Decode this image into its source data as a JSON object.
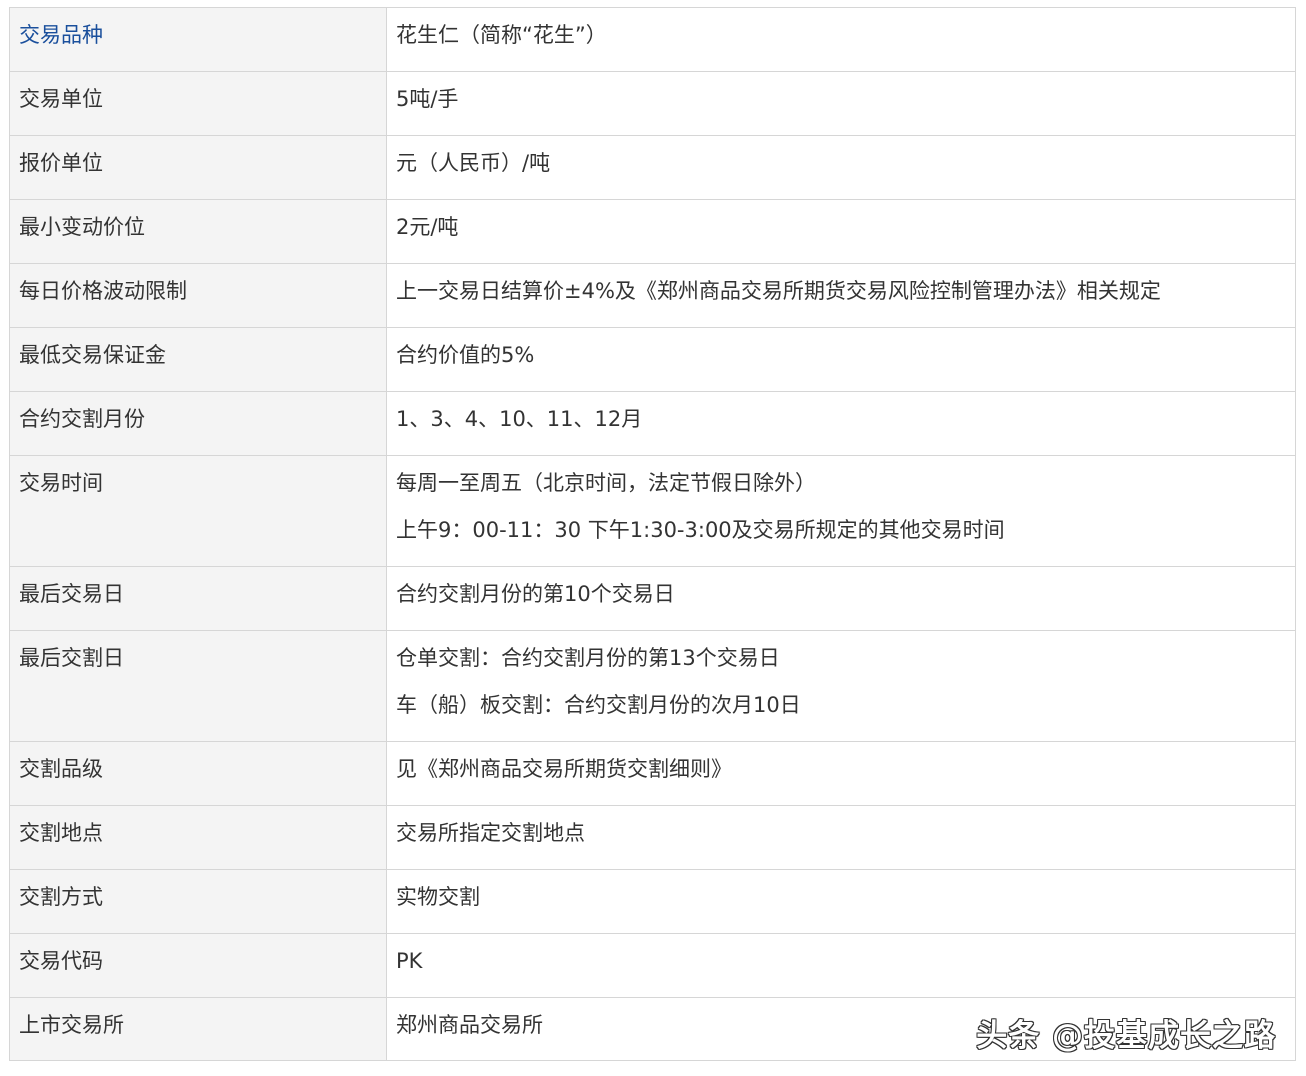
{
  "rows": [
    {
      "label": "交易品种",
      "values": [
        "花生仁（简称“花生”）"
      ]
    },
    {
      "label": "交易单位",
      "values": [
        "5吨/手"
      ]
    },
    {
      "label": "报价单位",
      "values": [
        "元（人民币）/吨"
      ]
    },
    {
      "label": "最小变动价位",
      "values": [
        "2元/吨"
      ]
    },
    {
      "label": "每日价格波动限制",
      "values": [
        "上一交易日结算价±4%及《郑州商品交易所期货交易风险控制管理办法》相关规定"
      ]
    },
    {
      "label": "最低交易保证金",
      "values": [
        "合约价值的5%"
      ]
    },
    {
      "label": "合约交割月份",
      "values": [
        "1、3、4、10、11、12月"
      ]
    },
    {
      "label": "交易时间",
      "values": [
        "每周一至周五（北京时间，法定节假日除外）",
        "上午9：00-11：30  下午1:30-3:00及交易所规定的其他交易时间"
      ]
    },
    {
      "label": "最后交易日",
      "values": [
        "合约交割月份的第10个交易日"
      ]
    },
    {
      "label": "最后交割日",
      "values": [
        "仓单交割：合约交割月份的第13个交易日",
        "车（船）板交割：合约交割月份的次月10日"
      ]
    },
    {
      "label": "交割品级",
      "values": [
        "见《郑州商品交易所期货交割细则》"
      ]
    },
    {
      "label": "交割地点",
      "values": [
        "交易所指定交割地点"
      ]
    },
    {
      "label": "交割方式",
      "values": [
        "实物交割"
      ]
    },
    {
      "label": "交易代码",
      "values": [
        "PK"
      ]
    },
    {
      "label": "上市交易所",
      "values": [
        "郑州商品交易所"
      ]
    }
  ],
  "watermark": "头条 @投基成长之路",
  "colors": {
    "label_bg": "#f4f4f4",
    "border": "#d6d6d6",
    "text": "#333333",
    "first_label_text": "#1a4f9c"
  }
}
